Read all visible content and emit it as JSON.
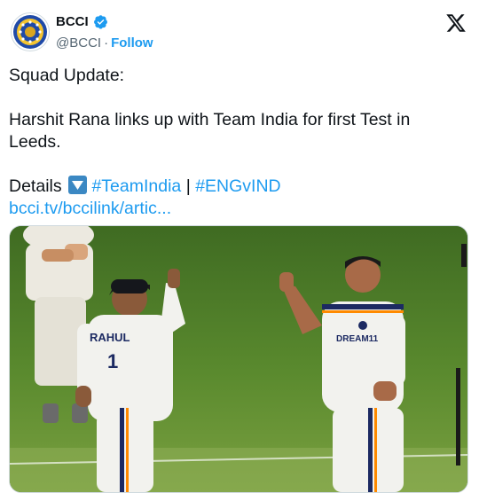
{
  "account": {
    "name": "BCCI",
    "handle": "@BCCI",
    "separator": "·",
    "follow_label": "Follow",
    "verified_icon": "verified-badge-icon",
    "brand_color": "#1d9bf0"
  },
  "platform": {
    "logo_icon": "x-logo-icon"
  },
  "tweet": {
    "line1": "Squad Update:",
    "line2": "Harshit Rana links up with Team India for first Test in Leeds.",
    "details_label": "Details",
    "details_emoji": "down-arrow-button-emoji",
    "hashtag1": "#TeamIndia",
    "pipe": "|",
    "hashtag2": "#ENGvIND",
    "url_text": "bcci.tv/bccilink/artic..."
  },
  "media": {
    "jersey_left": "RAHUL",
    "jersey_left_number": "1",
    "chest_brand_text": "DREAM11"
  }
}
